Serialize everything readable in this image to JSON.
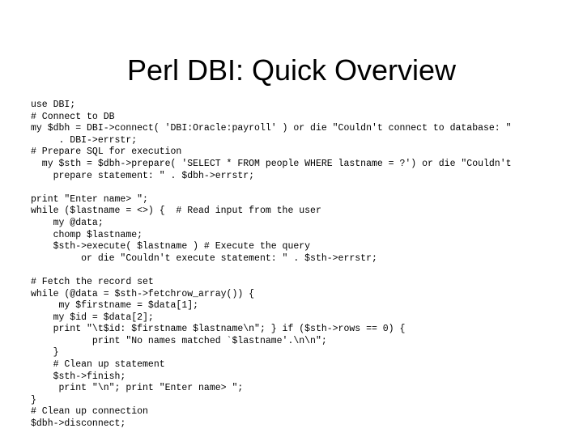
{
  "slide": {
    "title": "Perl DBI: Quick Overview",
    "background_color": "#ffffff",
    "text_color": "#000000"
  },
  "code": {
    "language": "perl",
    "lines": [
      "use DBI;",
      "# Connect to DB",
      "my $dbh = DBI->connect( 'DBI:Oracle:payroll' ) or die \"Couldn't connect to database: \"",
      "     . DBI->errstr;",
      "# Prepare SQL for execution",
      "  my $sth = $dbh->prepare( 'SELECT * FROM people WHERE lastname = ?') or die \"Couldn't",
      "    prepare statement: \" . $dbh->errstr;",
      "",
      "print \"Enter name> \";",
      "while ($lastname = <>) {  # Read input from the user",
      "    my @data;",
      "    chomp $lastname;",
      "    $sth->execute( $lastname ) # Execute the query",
      "         or die \"Couldn't execute statement: \" . $sth->errstr;",
      "",
      "# Fetch the record set",
      "while (@data = $sth->fetchrow_array()) {",
      "     my $firstname = $data[1];",
      "    my $id = $data[2];",
      "    print \"\\t$id: $firstname $lastname\\n\"; } if ($sth->rows == 0) {",
      "           print \"No names matched `$lastname'.\\n\\n\";",
      "    }",
      "    # Clean up statement",
      "    $sth->finish;",
      "     print \"\\n\"; print \"Enter name> \";",
      "}",
      "# Clean up connection",
      "$dbh->disconnect;"
    ]
  }
}
